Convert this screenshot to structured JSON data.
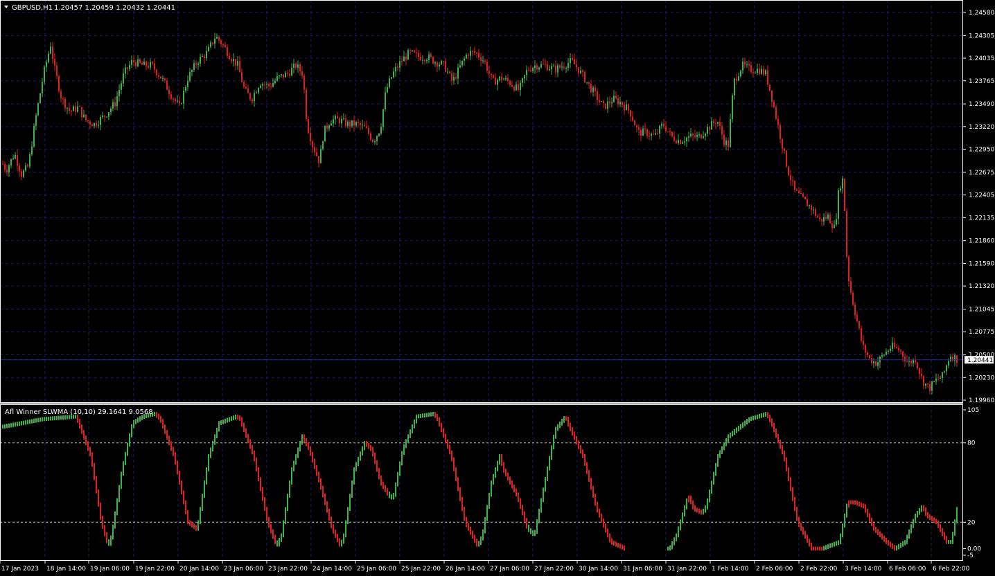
{
  "price_header": {
    "symbol_tf": "GBPUSD,H1",
    "ohlc": "1.20457 1.20459 1.20432 1.20441"
  },
  "indicator_header": "Afl Winner SLWMA (10,10) 29.1641 9.0568",
  "current_price_label": "1.20441",
  "colors": {
    "background": "#000000",
    "grid": "#1a1a66",
    "bull": "#3cb44a",
    "bear": "#e0201c",
    "axis": "#ffffff",
    "price_line": "#2a2aa0"
  },
  "chart_data": [
    {
      "type": "candlestick",
      "title": "GBPUSD,H1",
      "ylim": [
        1.1996,
        1.2458
      ],
      "y_ticks": [
        "1.24580",
        "1.24305",
        "1.24035",
        "1.23765",
        "1.23490",
        "1.23220",
        "1.22950",
        "1.22675",
        "1.22405",
        "1.22135",
        "1.21860",
        "1.21590",
        "1.21320",
        "1.21045",
        "1.20775",
        "1.20500",
        "1.20230",
        "1.19960"
      ],
      "current_price": 1.20441,
      "grid": true,
      "path": [
        [
          0,
          1.2282
        ],
        [
          8,
          1.227
        ],
        [
          20,
          1.229
        ],
        [
          30,
          1.2265
        ],
        [
          40,
          1.2275
        ],
        [
          50,
          1.233
        ],
        [
          62,
          1.2385
        ],
        [
          72,
          1.242
        ],
        [
          78,
          1.239
        ],
        [
          88,
          1.2355
        ],
        [
          100,
          1.234
        ],
        [
          112,
          1.2345
        ],
        [
          122,
          1.233
        ],
        [
          135,
          1.2325
        ],
        [
          150,
          1.2335
        ],
        [
          165,
          1.235
        ],
        [
          178,
          1.2385
        ],
        [
          190,
          1.24
        ],
        [
          205,
          1.2395
        ],
        [
          218,
          1.2395
        ],
        [
          232,
          1.238
        ],
        [
          246,
          1.236
        ],
        [
          258,
          1.2345
        ],
        [
          270,
          1.238
        ],
        [
          284,
          1.24
        ],
        [
          298,
          1.241
        ],
        [
          310,
          1.243
        ],
        [
          320,
          1.242
        ],
        [
          332,
          1.2405
        ],
        [
          342,
          1.2395
        ],
        [
          352,
          1.2365
        ],
        [
          362,
          1.2355
        ],
        [
          374,
          1.2375
        ],
        [
          388,
          1.237
        ],
        [
          400,
          1.238
        ],
        [
          414,
          1.2385
        ],
        [
          426,
          1.2395
        ],
        [
          436,
          1.2385
        ],
        [
          442,
          1.2325
        ],
        [
          450,
          1.23
        ],
        [
          460,
          1.228
        ],
        [
          466,
          1.2315
        ],
        [
          476,
          1.233
        ],
        [
          488,
          1.233
        ],
        [
          500,
          1.2325
        ],
        [
          514,
          1.2325
        ],
        [
          526,
          1.232
        ],
        [
          538,
          1.2305
        ],
        [
          548,
          1.232
        ],
        [
          556,
          1.2365
        ],
        [
          566,
          1.2385
        ],
        [
          578,
          1.24
        ],
        [
          590,
          1.241
        ],
        [
          604,
          1.2405
        ],
        [
          616,
          1.2405
        ],
        [
          626,
          1.24
        ],
        [
          640,
          1.2395
        ],
        [
          652,
          1.2375
        ],
        [
          664,
          1.2395
        ],
        [
          674,
          1.241
        ],
        [
          686,
          1.241
        ],
        [
          698,
          1.24
        ],
        [
          710,
          1.2375
        ],
        [
          722,
          1.238
        ],
        [
          734,
          1.2375
        ],
        [
          748,
          1.2365
        ],
        [
          760,
          1.239
        ],
        [
          772,
          1.2395
        ],
        [
          786,
          1.2395
        ],
        [
          800,
          1.239
        ],
        [
          812,
          1.2395
        ],
        [
          824,
          1.24
        ],
        [
          834,
          1.239
        ],
        [
          846,
          1.2375
        ],
        [
          858,
          1.236
        ],
        [
          870,
          1.2345
        ],
        [
          884,
          1.2355
        ],
        [
          896,
          1.235
        ],
        [
          908,
          1.234
        ],
        [
          920,
          1.2315
        ],
        [
          932,
          1.2315
        ],
        [
          944,
          1.231
        ],
        [
          956,
          1.2325
        ],
        [
          968,
          1.231
        ],
        [
          980,
          1.2305
        ],
        [
          994,
          1.231
        ],
        [
          1008,
          1.231
        ],
        [
          1020,
          1.232
        ],
        [
          1034,
          1.233
        ],
        [
          1044,
          1.2305
        ],
        [
          1050,
          1.23
        ],
        [
          1058,
          1.2375
        ],
        [
          1070,
          1.2395
        ],
        [
          1082,
          1.239
        ],
        [
          1094,
          1.239
        ],
        [
          1104,
          1.2385
        ],
        [
          1112,
          1.236
        ],
        [
          1120,
          1.233
        ],
        [
          1128,
          1.23
        ],
        [
          1136,
          1.227
        ],
        [
          1146,
          1.2245
        ],
        [
          1158,
          1.2235
        ],
        [
          1170,
          1.2225
        ],
        [
          1182,
          1.221
        ],
        [
          1194,
          1.2215
        ],
        [
          1204,
          1.22
        ],
        [
          1210,
          1.225
        ],
        [
          1216,
          1.226
        ],
        [
          1222,
          1.215
        ],
        [
          1228,
          1.212
        ],
        [
          1236,
          1.209
        ],
        [
          1244,
          1.206
        ],
        [
          1254,
          1.2045
        ],
        [
          1264,
          1.204
        ],
        [
          1274,
          1.205
        ],
        [
          1286,
          1.206
        ],
        [
          1298,
          1.2055
        ],
        [
          1310,
          1.204
        ],
        [
          1320,
          1.2045
        ],
        [
          1330,
          1.202
        ],
        [
          1340,
          1.201
        ],
        [
          1350,
          1.202
        ],
        [
          1360,
          1.2025
        ],
        [
          1370,
          1.205
        ],
        [
          1382,
          1.2044
        ]
      ],
      "x_ticks": [
        {
          "label": "17 Jan 2023",
          "x": 28
        },
        {
          "label": "18 Jan 14:00",
          "x": 93
        },
        {
          "label": "19 Jan 06:00",
          "x": 156
        },
        {
          "label": "19 Jan 22:00",
          "x": 221
        },
        {
          "label": "20 Jan 14:00",
          "x": 285
        },
        {
          "label": "23 Jan 06:00",
          "x": 349
        },
        {
          "label": "23 Jan 22:00",
          "x": 413
        },
        {
          "label": "24 Jan 14:00",
          "x": 477
        },
        {
          "label": "25 Jan 06:00",
          "x": 541
        },
        {
          "label": "25 Jan 22:00",
          "x": 605
        },
        {
          "label": "26 Jan 14:00",
          "x": 669
        },
        {
          "label": "27 Jan 06:00",
          "x": 733
        },
        {
          "label": "27 Jan 22:00",
          "x": 797
        },
        {
          "label": "30 Jan 14:00",
          "x": 861
        },
        {
          "label": "31 Jan 06:00",
          "x": 925
        },
        {
          "label": "31 Jan 22:00",
          "x": 989
        },
        {
          "label": "1 Feb 14:00",
          "x": 1053
        },
        {
          "label": "2 Feb 06:00",
          "x": 1117
        },
        {
          "label": "2 Feb 22:00",
          "x": 1181
        },
        {
          "label": "3 Feb 14:00",
          "x": 1245
        },
        {
          "label": "6 Feb 06:00",
          "x": 1309
        },
        {
          "label": "6 Feb 22:00",
          "x": 1372
        }
      ]
    },
    {
      "type": "bar",
      "title": "Afl Winner SLWMA (10,10) 29.1641 9.0568",
      "ylim": [
        -5,
        105
      ],
      "y_ticks": [
        "105",
        "80",
        "20",
        "0.00",
        "-5"
      ],
      "levels": [
        80,
        20
      ],
      "oscillator_path": [
        [
          0,
          92,
          1
        ],
        [
          60,
          98,
          1
        ],
        [
          108,
          100,
          1
        ],
        [
          110,
          98,
          0
        ],
        [
          130,
          70,
          0
        ],
        [
          145,
          20,
          0
        ],
        [
          155,
          2,
          0
        ],
        [
          160,
          10,
          1
        ],
        [
          175,
          60,
          1
        ],
        [
          190,
          95,
          1
        ],
        [
          205,
          100,
          1
        ],
        [
          222,
          102,
          1
        ],
        [
          230,
          98,
          0
        ],
        [
          250,
          70,
          0
        ],
        [
          270,
          20,
          0
        ],
        [
          282,
          15,
          0
        ],
        [
          285,
          20,
          1
        ],
        [
          300,
          70,
          1
        ],
        [
          315,
          95,
          1
        ],
        [
          340,
          100,
          1
        ],
        [
          345,
          98,
          0
        ],
        [
          365,
          70,
          0
        ],
        [
          385,
          20,
          0
        ],
        [
          398,
          2,
          0
        ],
        [
          405,
          10,
          1
        ],
        [
          420,
          60,
          1
        ],
        [
          435,
          85,
          1
        ],
        [
          445,
          75,
          0
        ],
        [
          460,
          50,
          0
        ],
        [
          478,
          15,
          0
        ],
        [
          490,
          2,
          0
        ],
        [
          495,
          10,
          1
        ],
        [
          510,
          60,
          1
        ],
        [
          525,
          80,
          1
        ],
        [
          535,
          75,
          0
        ],
        [
          548,
          50,
          0
        ],
        [
          560,
          40,
          0
        ],
        [
          566,
          38,
          1
        ],
        [
          580,
          75,
          1
        ],
        [
          600,
          100,
          1
        ],
        [
          625,
          102,
          1
        ],
        [
          630,
          98,
          0
        ],
        [
          650,
          70,
          0
        ],
        [
          670,
          20,
          0
        ],
        [
          688,
          2,
          0
        ],
        [
          695,
          10,
          1
        ],
        [
          708,
          50,
          1
        ],
        [
          720,
          70,
          1
        ],
        [
          725,
          60,
          0
        ],
        [
          745,
          40,
          0
        ],
        [
          760,
          15,
          0
        ],
        [
          770,
          10,
          1
        ],
        [
          785,
          50,
          1
        ],
        [
          800,
          90,
          1
        ],
        [
          815,
          100,
          1
        ],
        [
          818,
          95,
          0
        ],
        [
          840,
          70,
          0
        ],
        [
          860,
          30,
          0
        ],
        [
          880,
          5,
          0
        ],
        [
          900,
          0,
          0
        ],
        [
          965,
          0,
          1
        ],
        [
          975,
          10,
          1
        ],
        [
          992,
          40,
          1
        ],
        [
          1000,
          30,
          0
        ],
        [
          1012,
          27,
          0
        ],
        [
          1018,
          32,
          1
        ],
        [
          1035,
          70,
          1
        ],
        [
          1050,
          85,
          1
        ],
        [
          1080,
          98,
          1
        ],
        [
          1105,
          102,
          1
        ],
        [
          1112,
          95,
          0
        ],
        [
          1130,
          70,
          0
        ],
        [
          1150,
          20,
          0
        ],
        [
          1170,
          0,
          0
        ],
        [
          1185,
          0,
          0
        ],
        [
          1210,
          5,
          1
        ],
        [
          1222,
          35,
          1
        ],
        [
          1232,
          35,
          0
        ],
        [
          1245,
          32,
          0
        ],
        [
          1260,
          15,
          0
        ],
        [
          1278,
          5,
          0
        ],
        [
          1290,
          0,
          0
        ],
        [
          1305,
          5,
          1
        ],
        [
          1320,
          25,
          1
        ],
        [
          1330,
          32,
          1
        ],
        [
          1336,
          25,
          0
        ],
        [
          1350,
          20,
          0
        ],
        [
          1365,
          5,
          0
        ],
        [
          1372,
          5,
          1
        ],
        [
          1380,
          30,
          1
        ]
      ]
    }
  ]
}
